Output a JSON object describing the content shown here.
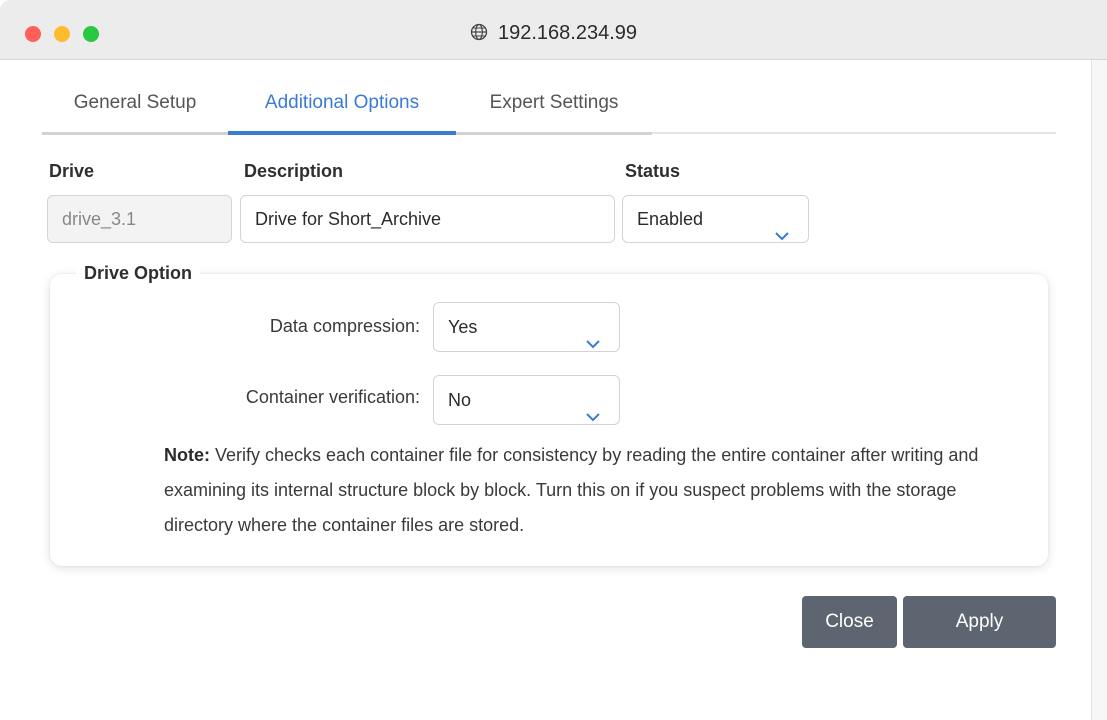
{
  "window": {
    "title": "192.168.234.99"
  },
  "tabs": [
    {
      "label": "General Setup",
      "active": false
    },
    {
      "label": "Additional Options",
      "active": true
    },
    {
      "label": "Expert Settings",
      "active": false
    }
  ],
  "columns": {
    "drive": "Drive",
    "description": "Description",
    "status": "Status"
  },
  "fields": {
    "drive_value": "drive_3.1",
    "description_value": "Drive for Short_Archive",
    "status_value": "Enabled"
  },
  "drive_option": {
    "legend": "Drive Option",
    "compression_label": "Data compression:",
    "compression_value": "Yes",
    "verification_label": "Container verification:",
    "verification_value": "No",
    "note_prefix": "Note:",
    "note_text": " Verify checks each container file for consistency by reading the entire container after writing and examining its internal structure block by block. Turn this on if you suspect problems with the storage directory where the container files are stored."
  },
  "buttons": {
    "close": "Close",
    "apply": "Apply"
  },
  "colors": {
    "accent": "#3a7bd5",
    "button": "#5d6570"
  },
  "icons": {
    "title": "globe-icon",
    "dropdown": "chevron-down-icon"
  }
}
